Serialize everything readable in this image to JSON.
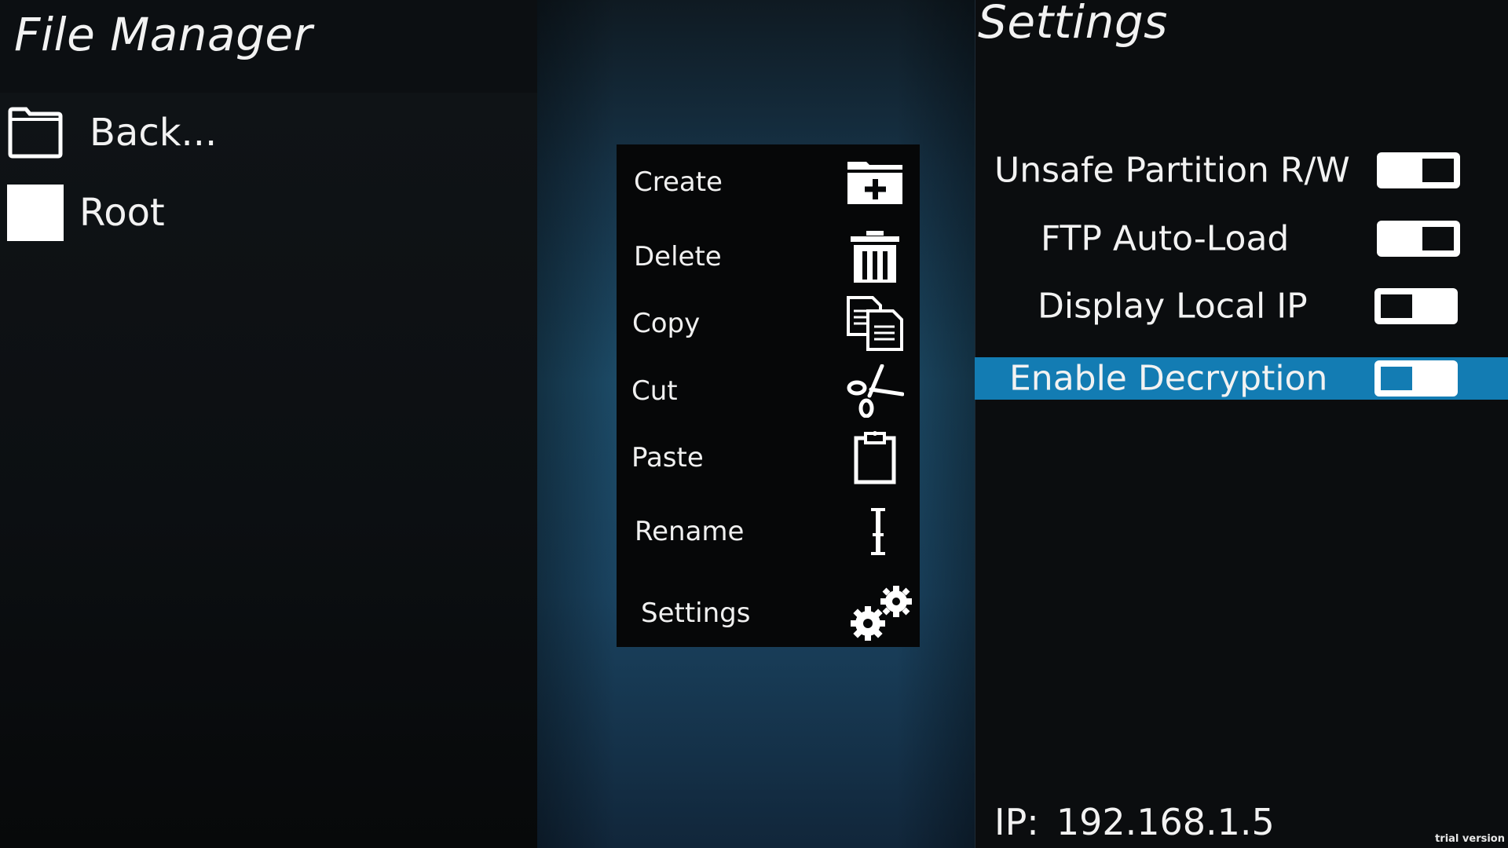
{
  "file_manager": {
    "title": "File Manager",
    "entries": [
      {
        "label": "Back...",
        "icon": "folder-icon"
      },
      {
        "label": "Root",
        "icon": "drive-icon"
      }
    ]
  },
  "context_menu": {
    "items": [
      {
        "label": "Create",
        "icon": "create-folder-icon"
      },
      {
        "label": "Delete",
        "icon": "trash-icon"
      },
      {
        "label": "Copy",
        "icon": "copy-icon"
      },
      {
        "label": "Cut",
        "icon": "scissors-icon"
      },
      {
        "label": "Paste",
        "icon": "clipboard-icon"
      },
      {
        "label": "Rename",
        "icon": "text-cursor-icon"
      },
      {
        "label": "Settings",
        "icon": "gears-icon"
      }
    ]
  },
  "settings": {
    "title": "Settings",
    "options": [
      {
        "label": "Unsafe Partition R/W",
        "enabled": true,
        "selected": false
      },
      {
        "label": "FTP Auto-Load",
        "enabled": true,
        "selected": false
      },
      {
        "label": "Display Local IP",
        "enabled": false,
        "selected": false
      },
      {
        "label": "Enable Decryption",
        "enabled": false,
        "selected": true
      }
    ],
    "ip_label": "IP:",
    "ip_value": "192.168.1.5"
  },
  "colors": {
    "selection": "#137cb3",
    "background": "#0b0d0f",
    "text": "#f2f2f2"
  },
  "watermark": "trial version"
}
